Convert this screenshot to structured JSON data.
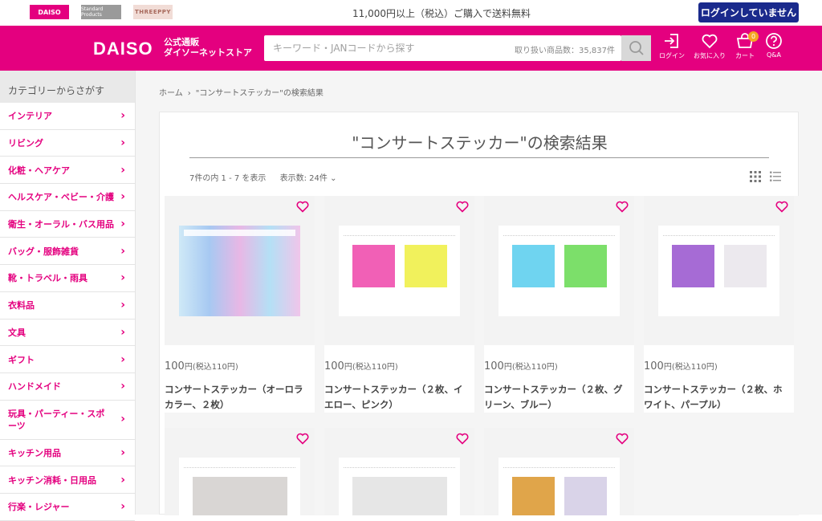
{
  "topbar": {
    "brand_daiso": "DAISO",
    "brand_standard": "Standard Products",
    "brand_threeppy": "THREEPPY",
    "free_shipping": "11,000円以上（税込）ご購入で送料無料",
    "login_status": "ログインしていません"
  },
  "header": {
    "logo": "DAISO",
    "logo_sub_line1": "公式通販",
    "logo_sub_line2": "ダイソーネットストア",
    "search_placeholder": "キーワード・JANコードから探す",
    "search_count": "取り扱い商品数：35,837件",
    "icons": {
      "login": "ログイン",
      "favorites": "お気に入り",
      "cart": "カート",
      "cart_count": "0",
      "qa": "Q&A"
    }
  },
  "sidebar": {
    "title": "カテゴリーからさがす",
    "items": [
      {
        "label": "インテリア"
      },
      {
        "label": "リビング"
      },
      {
        "label": "化粧・ヘアケア"
      },
      {
        "label": "ヘルスケア・ベビー・介護"
      },
      {
        "label": "衛生・オーラル・バス用品"
      },
      {
        "label": "バッグ・服飾雑貨"
      },
      {
        "label": "靴・トラベル・雨具"
      },
      {
        "label": "衣料品"
      },
      {
        "label": "文具"
      },
      {
        "label": "ギフト"
      },
      {
        "label": "ハンドメイド"
      },
      {
        "label": "玩具・パーティー・スポーツ"
      },
      {
        "label": "キッチン用品"
      },
      {
        "label": "キッチン消耗・日用品"
      },
      {
        "label": "行楽・レジャー"
      }
    ]
  },
  "breadcrumb": {
    "home": "ホーム",
    "separator": "›",
    "current": "\"コンサートステッカー\"の検索結果"
  },
  "results": {
    "title": "\"コンサートステッカー\"の検索結果",
    "count_text": "7件の内 1 - 7 を表示",
    "per_page": "表示数: 24件",
    "products": [
      {
        "price": "100",
        "yen_tax": "円(税込110円)",
        "name": "コンサートステッカー（オーロラカラー、２枚）",
        "colors": [
          "#a9d8f5",
          "#f2b6e0"
        ]
      },
      {
        "price": "100",
        "yen_tax": "円(税込110円)",
        "name": "コンサートステッカー（２枚、イエロー、ピンク）",
        "colors": [
          "#ef4fae",
          "#f0ef4a"
        ]
      },
      {
        "price": "100",
        "yen_tax": "円(税込110円)",
        "name": "コンサートステッカー（２枚、グリーン、ブルー）",
        "colors": [
          "#5fcfee",
          "#6edc5a"
        ]
      },
      {
        "price": "100",
        "yen_tax": "円(税込110円)",
        "name": "コンサートステッカー（２枚、ホワイト、パープル）",
        "colors": [
          "#9c5bd0",
          "#ece9ee"
        ]
      },
      {
        "colors": [
          "#d9d6d4",
          "#d9d6d4"
        ]
      },
      {
        "colors": [
          "#e6e6e6",
          "#e6e6e6"
        ]
      },
      {
        "colors": [
          "#e0a54a",
          "#d9d3e8"
        ]
      }
    ]
  },
  "colors": {
    "brand_pink": "#e4007f",
    "login_navy": "#1a2a8c"
  }
}
